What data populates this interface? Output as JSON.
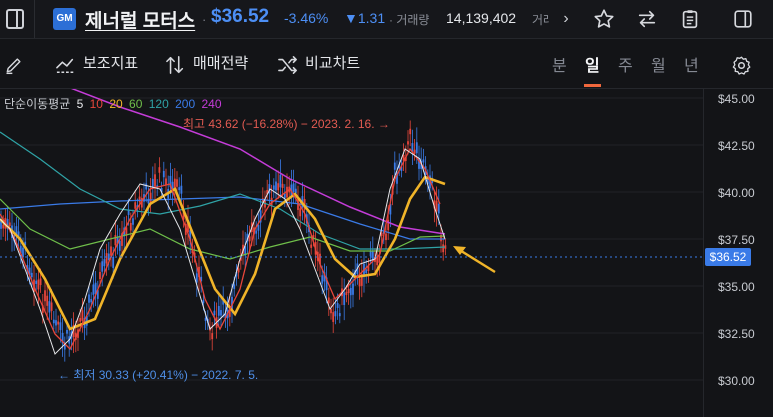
{
  "header": {
    "logo_text": "GM",
    "stock_name": "제너럴 모터스",
    "separator": "·",
    "price": "$36.52",
    "change_pct": "-3.46%",
    "change_amount": "▼1.31",
    "volume_label": "· 거래량",
    "volume_value": "14,139,402",
    "volume_cut": "거래",
    "more": "›"
  },
  "toolbar": {
    "indicators_label": "보조지표",
    "strategy_label": "매매전략",
    "compare_label": "비교차트",
    "periods": [
      "분",
      "일",
      "주",
      "월",
      "년"
    ],
    "active_period": "일"
  },
  "legend": {
    "title": "단순이동평균",
    "items": [
      {
        "label": "5",
        "color": "#e6e7ea"
      },
      {
        "label": "10",
        "color": "#e8463b"
      },
      {
        "label": "20",
        "color": "#f0b429"
      },
      {
        "label": "60",
        "color": "#6fbf4a"
      },
      {
        "label": "120",
        "color": "#2fa3a6"
      },
      {
        "label": "200",
        "color": "#3a7be8"
      },
      {
        "label": "240",
        "color": "#c43cd8"
      }
    ]
  },
  "annotations": {
    "high": "최고 43.62 (−16.28%) − 2023. 2. 16. →",
    "low": "← 최저 30.33 (+20.41%) − 2022. 7. 5."
  },
  "yaxis": {
    "labels": [
      "$45.00",
      "$42.50",
      "$40.00",
      "$37.50",
      "$35.00",
      "$32.50",
      "$30.00"
    ],
    "current_price": "$36.52"
  },
  "colors": {
    "up": "#e8463b",
    "down": "#3a7be8",
    "accent": "#f0683d",
    "price": "#4d8ff5"
  },
  "chart_data": {
    "type": "candlestick",
    "period": "daily",
    "ylim": [
      30,
      45
    ],
    "high": 43.62,
    "low": 30.33,
    "last": 36.52,
    "moving_averages": [
      5,
      10,
      20,
      60,
      120,
      200,
      240
    ]
  }
}
